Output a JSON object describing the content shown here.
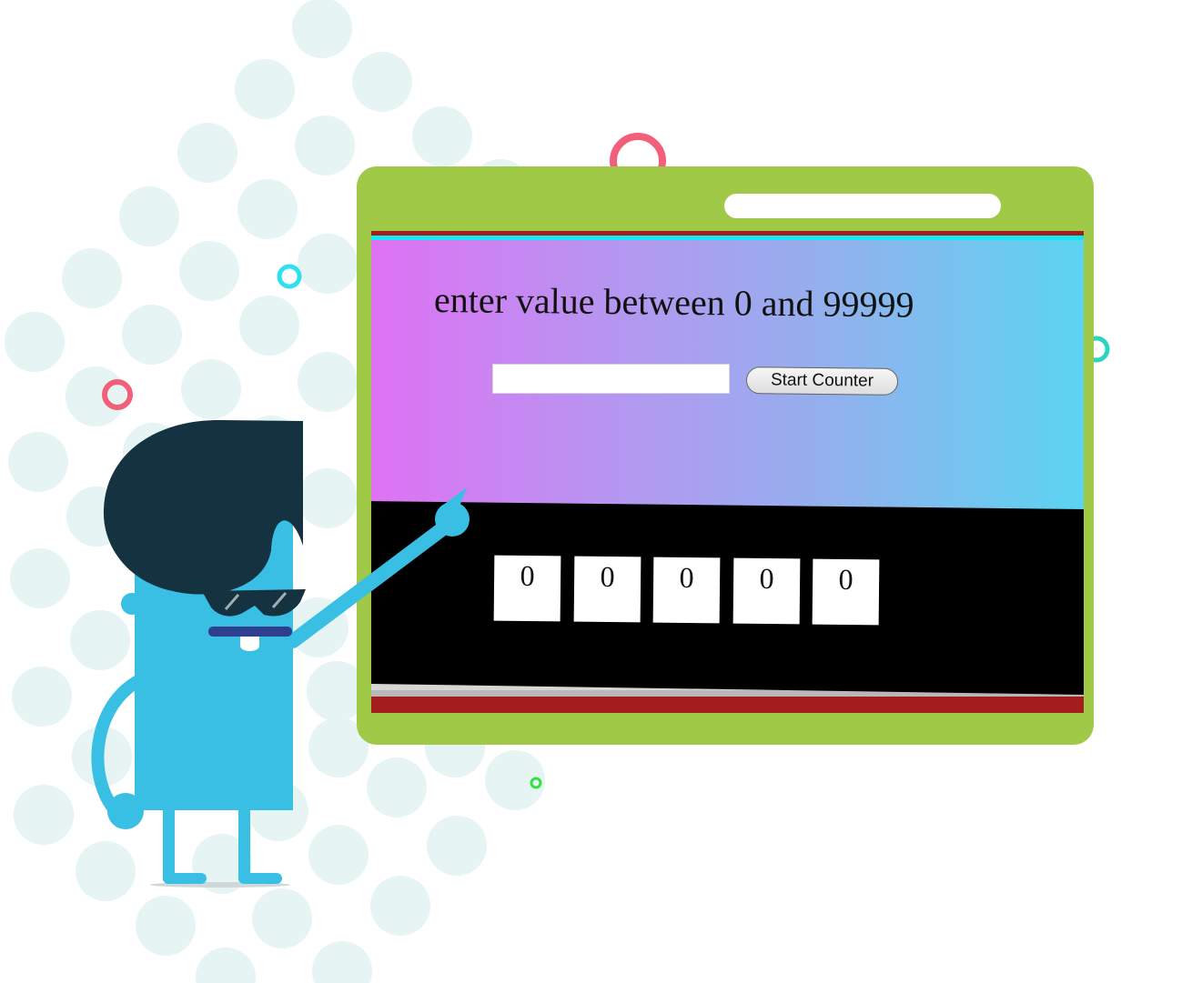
{
  "counter_app": {
    "prompt": "enter value between 0 and 99999",
    "input": {
      "value": "",
      "placeholder": ""
    },
    "start_button_label": "Start Counter",
    "digits": [
      "0",
      "0",
      "0",
      "0",
      "0"
    ]
  },
  "colors": {
    "board": "#a0c948",
    "gradient_left": "#df72f4",
    "gradient_right": "#5bd4f1",
    "counter_background": "#000000",
    "accent_red": "#a31d1d",
    "character_body": "#38bfe3",
    "character_hair": "#143240"
  },
  "illustration": {
    "character": "cartoon-presenter-pointing",
    "decorations": [
      "dot-pattern",
      "pink-ring",
      "cyan-ring",
      "green-ring"
    ]
  }
}
